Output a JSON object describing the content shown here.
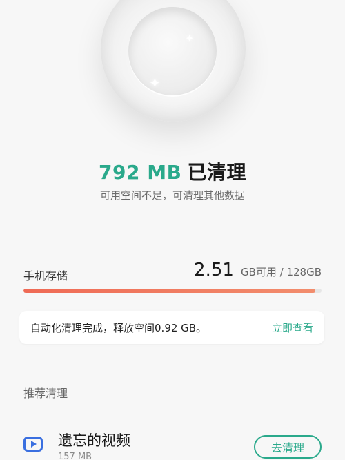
{
  "colors": {
    "accent": "#2aa98b",
    "storage_bar": "#ef6a55",
    "video_icon": "#3a6fe0",
    "background": "#f7f7f7"
  },
  "illustration": {
    "icon": "clean-bowl-illustration"
  },
  "result": {
    "amount": "792 MB",
    "label": "已清理",
    "subtitle": "可用空间不足，可清理其他数据"
  },
  "storage": {
    "label": "手机存储",
    "available_value": "2.51",
    "available_unit_text": "GB可用 / 128GB",
    "used_fraction": 0.98
  },
  "notice": {
    "text": "自动化清理完成，释放空间0.92 GB。",
    "link_label": "立即查看"
  },
  "recommend": {
    "section_title": "推荐清理",
    "items": [
      {
        "icon": "video-icon",
        "title": "遗忘的视频",
        "size": "157 MB",
        "button_label": "去清理"
      }
    ]
  }
}
